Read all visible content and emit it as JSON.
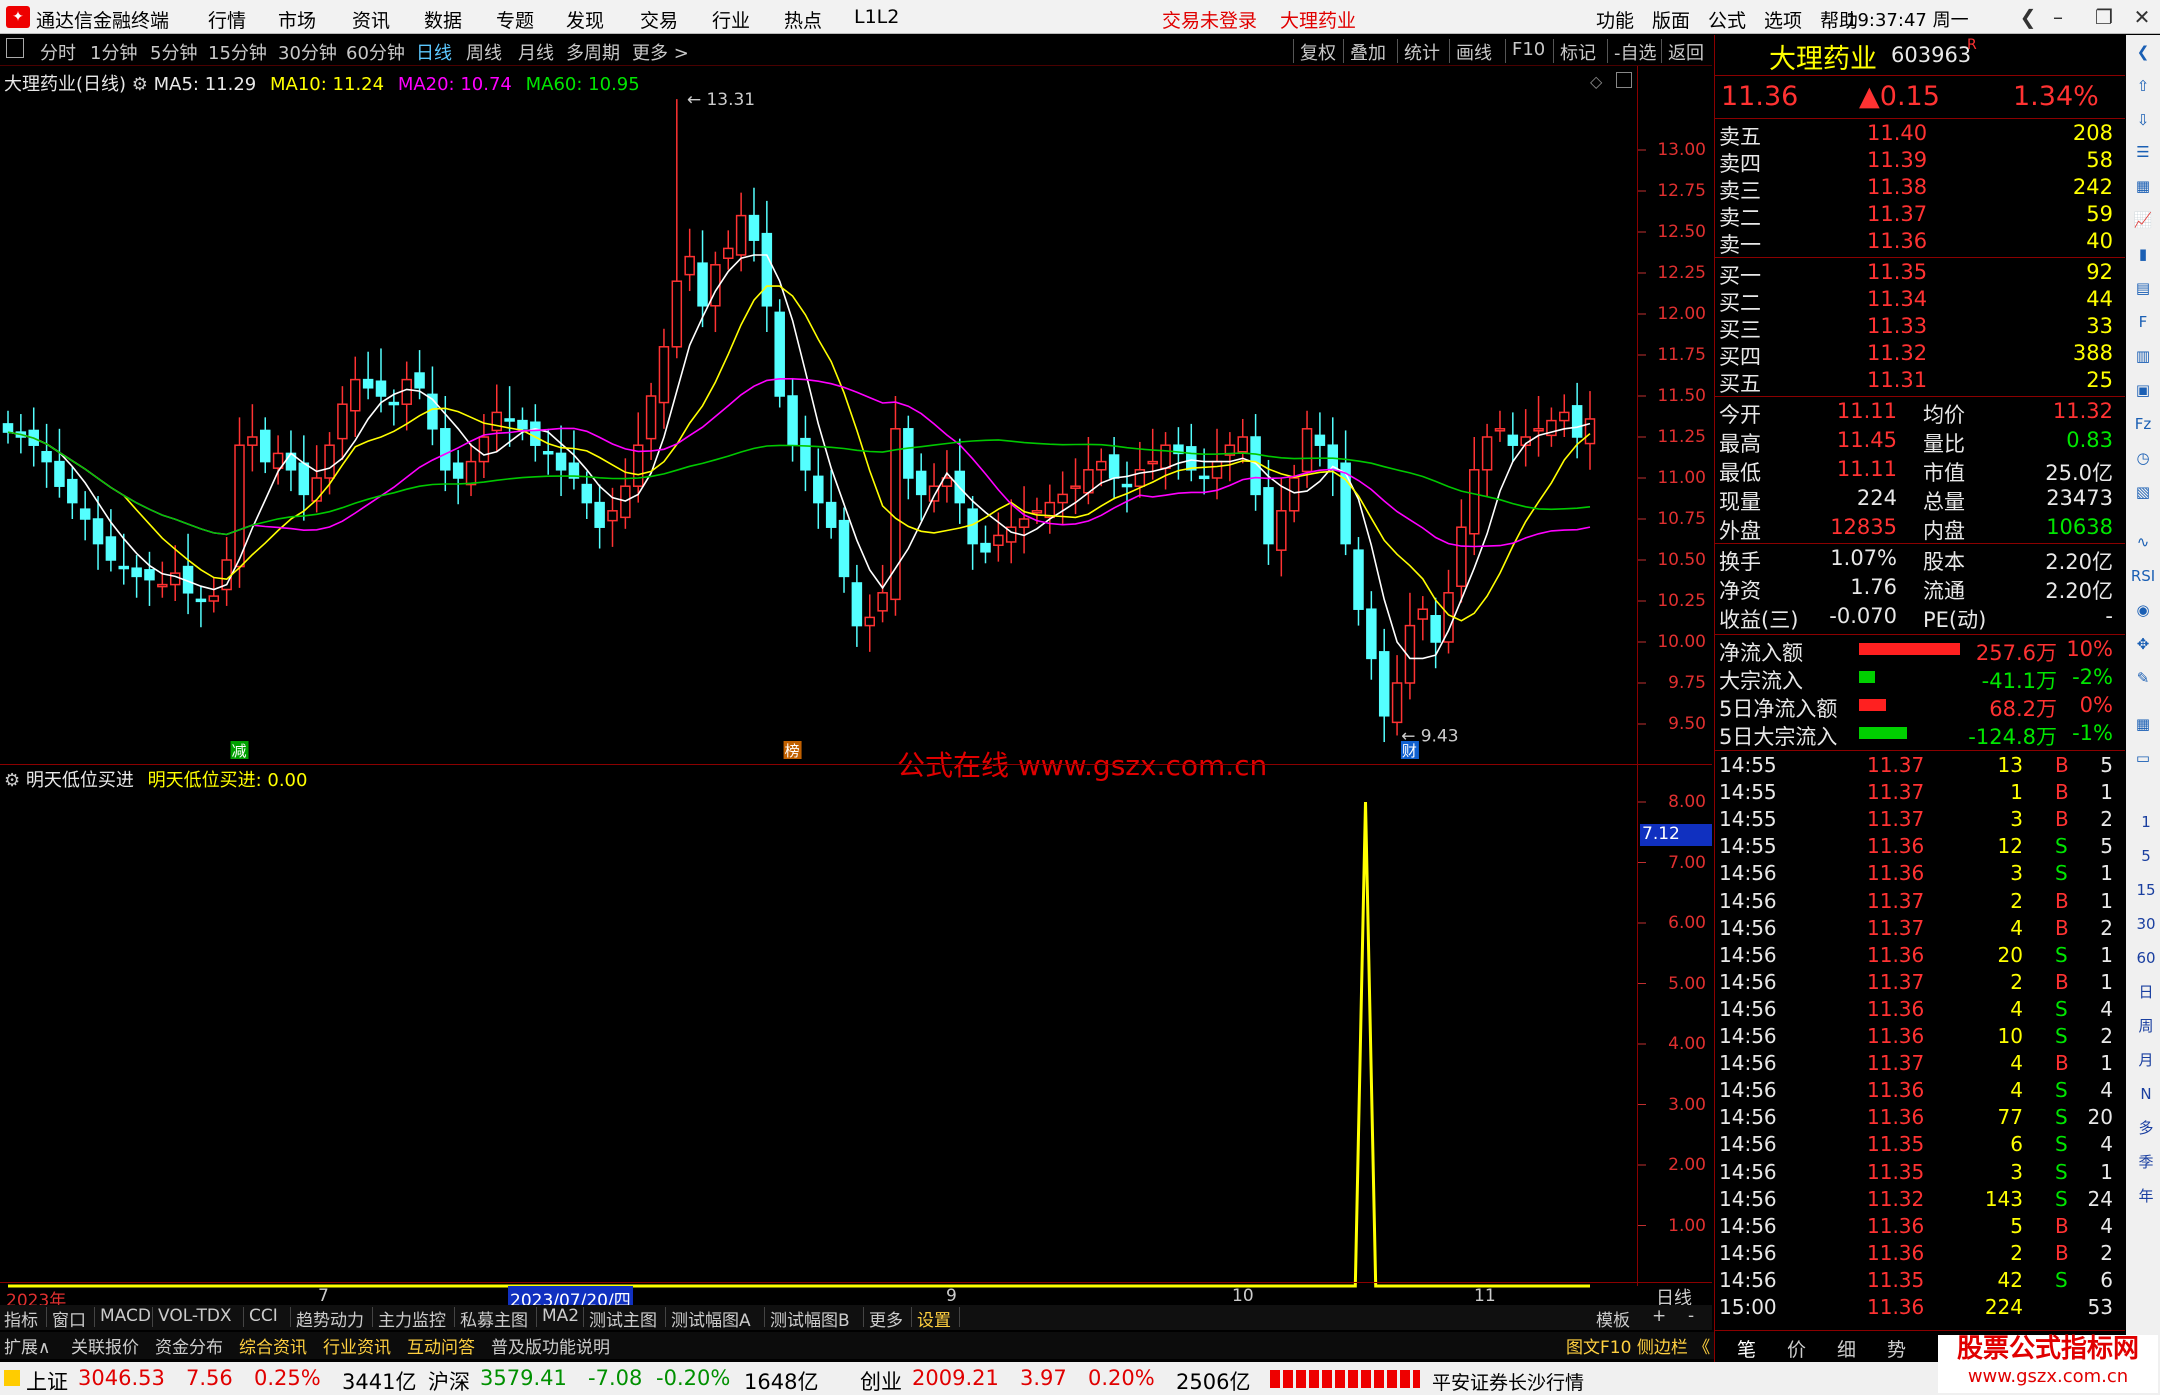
{
  "app": {
    "title": "通达信金融终端",
    "menus": [
      "行情",
      "市场",
      "资讯",
      "数据",
      "专题",
      "发现",
      "交易",
      "行业",
      "热点",
      "L1L2"
    ],
    "trade_status": "交易未登录",
    "stock_name_title": "大理药业",
    "right_menus": [
      "功能",
      "版面",
      "公式",
      "选项",
      "帮助"
    ],
    "time": "19:37:47 周一"
  },
  "toolbar": {
    "periods": [
      "分时",
      "1分钟",
      "5分钟",
      "15分钟",
      "30分钟",
      "60分钟",
      "日线",
      "周线",
      "月线",
      "多周期",
      "更多 >"
    ],
    "selected": "日线",
    "actions": [
      "复权",
      "叠加",
      "统计",
      "画线",
      "F10",
      "标记",
      "-自选",
      "返回"
    ]
  },
  "main_chart": {
    "legend_name": "大理药业(日线)",
    "ma5": "MA5: 11.29",
    "ma10": "MA10: 11.24",
    "ma20": "MA20: 10.74",
    "ma60": "MA60: 10.95",
    "high_mark": "13.31",
    "low_mark": "9.43",
    "markers": [
      "减",
      "榜",
      "财"
    ],
    "y_labels": [
      "13.00",
      "12.75",
      "12.50",
      "12.25",
      "12.00",
      "11.75",
      "11.50",
      "11.25",
      "11.00",
      "10.75",
      "10.50",
      "10.25",
      "10.00",
      "9.75",
      "9.50"
    ],
    "watermark": "公式在线  www.gszx.com.cn"
  },
  "indicator": {
    "name": "明天低位买进",
    "value_label": "明天低位买进: 0.00",
    "cursor_value": "7.12",
    "y_labels": [
      "8.00",
      "7.00",
      "6.00",
      "5.00",
      "4.00",
      "3.00",
      "2.00",
      "1.00"
    ]
  },
  "date_axis": {
    "labels": [
      "2023年",
      "7",
      "2023/07/20/四",
      "9",
      "10",
      "11"
    ],
    "period": "日线"
  },
  "chart_data": {
    "type": "line",
    "title": "",
    "series": [
      {
        "name": "明天低位买进",
        "values": [
          0,
          0,
          0,
          0,
          0,
          0,
          0,
          0,
          0,
          0,
          0,
          0,
          0,
          0,
          0,
          0,
          0,
          0,
          0,
          0,
          0,
          0,
          0,
          0,
          0,
          0,
          0,
          0,
          0,
          0,
          0,
          0,
          0,
          0,
          0,
          0,
          0,
          0,
          0,
          0,
          0,
          0,
          0,
          0,
          0,
          0,
          0,
          0,
          0,
          0,
          0,
          0,
          0,
          0,
          0,
          0,
          0,
          0,
          0,
          0,
          0,
          0,
          0,
          0,
          0,
          0,
          0,
          0,
          0,
          0,
          0,
          0,
          0,
          0,
          0,
          0,
          0,
          0,
          0,
          0,
          0,
          0,
          0,
          0,
          0,
          0,
          0,
          0,
          0,
          0,
          0,
          0,
          0,
          0,
          0,
          0,
          0,
          0,
          0,
          0,
          0,
          0,
          0,
          0,
          0,
          0,
          0,
          0,
          0,
          0,
          0,
          0,
          0,
          0,
          0,
          0,
          0,
          0,
          0,
          0,
          0,
          0,
          0,
          0,
          0,
          0,
          0,
          0,
          0,
          0,
          0,
          0,
          0,
          8,
          0,
          0,
          0,
          0,
          0,
          0,
          0,
          0,
          0,
          0,
          0,
          0,
          0,
          0,
          0,
          0,
          0,
          0,
          0,
          0,
          0,
          0
        ]
      }
    ],
    "ylim": [
      0,
      8.5
    ],
    "xlabel": "",
    "ylabel": ""
  },
  "quote": {
    "name": "大理药业",
    "code": "603963",
    "flag": "R",
    "price": "11.36",
    "change": "▲0.15",
    "pct": "1.34%",
    "asks": [
      {
        "label": "卖五",
        "price": "11.40",
        "vol": "208"
      },
      {
        "label": "卖四",
        "price": "11.39",
        "vol": "58"
      },
      {
        "label": "卖三",
        "price": "11.38",
        "vol": "242"
      },
      {
        "label": "卖二",
        "price": "11.37",
        "vol": "59"
      },
      {
        "label": "卖一",
        "price": "11.36",
        "vol": "40"
      }
    ],
    "bids": [
      {
        "label": "买一",
        "price": "11.35",
        "vol": "92"
      },
      {
        "label": "买二",
        "price": "11.34",
        "vol": "44"
      },
      {
        "label": "买三",
        "price": "11.33",
        "vol": "33"
      },
      {
        "label": "买四",
        "price": "11.32",
        "vol": "388"
      },
      {
        "label": "买五",
        "price": "11.31",
        "vol": "25"
      }
    ],
    "stats": [
      {
        "l1": "今开",
        "v1": "11.11",
        "l2": "均价",
        "v2": "11.32"
      },
      {
        "l1": "最高",
        "v1": "11.45",
        "l2": "量比",
        "v2": "0.83"
      },
      {
        "l1": "最低",
        "v1": "11.11",
        "l2": "市值",
        "v2": "25.0亿"
      },
      {
        "l1": "现量",
        "v1": "224",
        "l2": "总量",
        "v2": "23473"
      },
      {
        "l1": "外盘",
        "v1": "12835",
        "l2": "内盘",
        "v2": "10638"
      }
    ],
    "stats2": [
      {
        "l1": "换手",
        "v1": "1.07%",
        "l2": "股本",
        "v2": "2.20亿"
      },
      {
        "l1": "净资",
        "v1": "1.76",
        "l2": "流通",
        "v2": "2.20亿"
      },
      {
        "l1": "收益(三)",
        "v1": "-0.070",
        "l2": "PE(动)",
        "v2": "-"
      }
    ],
    "flows": [
      {
        "label": "净流入额",
        "value": "257.6万",
        "pct": "10%",
        "bar": 0.95,
        "color": "#ff2020"
      },
      {
        "label": "大宗流入",
        "value": "-41.1万",
        "pct": "-2%",
        "bar": 0.15,
        "color": "#00d000"
      },
      {
        "label": "5日净流入额",
        "value": "68.2万",
        "pct": "0%",
        "bar": 0.25,
        "color": "#ff2020"
      },
      {
        "label": "5日大宗流入",
        "value": "-124.8万",
        "pct": "-1%",
        "bar": 0.45,
        "color": "#00d000"
      }
    ],
    "ticks": [
      {
        "t": "14:55",
        "p": "11.37",
        "v": "13",
        "s": "B",
        "n": "5"
      },
      {
        "t": "14:55",
        "p": "11.37",
        "v": "1",
        "s": "B",
        "n": "1"
      },
      {
        "t": "14:55",
        "p": "11.37",
        "v": "3",
        "s": "B",
        "n": "2"
      },
      {
        "t": "14:55",
        "p": "11.36",
        "v": "12",
        "s": "S",
        "n": "5"
      },
      {
        "t": "14:56",
        "p": "11.36",
        "v": "3",
        "s": "S",
        "n": "1"
      },
      {
        "t": "14:56",
        "p": "11.37",
        "v": "2",
        "s": "B",
        "n": "1"
      },
      {
        "t": "14:56",
        "p": "11.37",
        "v": "4",
        "s": "B",
        "n": "2"
      },
      {
        "t": "14:56",
        "p": "11.36",
        "v": "20",
        "s": "S",
        "n": "1"
      },
      {
        "t": "14:56",
        "p": "11.37",
        "v": "2",
        "s": "B",
        "n": "1"
      },
      {
        "t": "14:56",
        "p": "11.36",
        "v": "4",
        "s": "S",
        "n": "4"
      },
      {
        "t": "14:56",
        "p": "11.36",
        "v": "10",
        "s": "S",
        "n": "2"
      },
      {
        "t": "14:56",
        "p": "11.37",
        "v": "4",
        "s": "B",
        "n": "1"
      },
      {
        "t": "14:56",
        "p": "11.36",
        "v": "4",
        "s": "S",
        "n": "4"
      },
      {
        "t": "14:56",
        "p": "11.36",
        "v": "77",
        "s": "S",
        "n": "20"
      },
      {
        "t": "14:56",
        "p": "11.35",
        "v": "6",
        "s": "S",
        "n": "4"
      },
      {
        "t": "14:56",
        "p": "11.35",
        "v": "3",
        "s": "S",
        "n": "1"
      },
      {
        "t": "14:56",
        "p": "11.32",
        "v": "143",
        "s": "S",
        "n": "24"
      },
      {
        "t": "14:56",
        "p": "11.36",
        "v": "5",
        "s": "B",
        "n": "4"
      },
      {
        "t": "14:56",
        "p": "11.36",
        "v": "2",
        "s": "B",
        "n": "2"
      },
      {
        "t": "14:56",
        "p": "11.35",
        "v": "42",
        "s": "S",
        "n": "6"
      },
      {
        "t": "15:00",
        "p": "11.36",
        "v": "224",
        "s": "",
        "n": "53"
      }
    ],
    "panel_tabs": [
      "笔",
      "价",
      "细",
      "势"
    ],
    "side_tool_labels": [
      "1",
      "5",
      "15",
      "30",
      "60",
      "日",
      "周",
      "月",
      "N",
      "多",
      "季",
      "年"
    ]
  },
  "tabs_row1": [
    "指标",
    "窗口",
    "MACD",
    "VOL-TDX",
    "CCI",
    "趋势动力",
    "主力监控",
    "私募主图",
    "MA2",
    "测试主图",
    "测试幅图A",
    "测试幅图B",
    "更多",
    "设置"
  ],
  "tabs_row1_right": [
    "模板",
    "+",
    "-"
  ],
  "tabs_row2": [
    "扩展∧",
    "关联报价",
    "资金分布",
    "综合资讯",
    "行业资讯",
    "互动问答",
    "普及版功能说明"
  ],
  "tabs_row2_right": "图文F10 侧边栏 《",
  "status": {
    "indexes": [
      {
        "name": "上证",
        "val": "3046.53",
        "chg": "7.56",
        "pct": "0.25%",
        "amt": "3441亿",
        "color": "red"
      },
      {
        "name": "沪深",
        "val": "3579.41",
        "chg": "-7.08",
        "pct": "-0.20%",
        "amt": "1648亿",
        "color": "green"
      },
      {
        "name": "创业",
        "val": "2009.21",
        "chg": "3.97",
        "pct": "0.20%",
        "amt": "2506亿",
        "color": "red"
      }
    ],
    "broker": "平安证券长沙行情",
    "logo_text": "股票公式指标网",
    "logo_url": "www.gszx.com.cn"
  },
  "colors": {
    "up": "#ff3232",
    "down": "#54ffff",
    "ma5": "#ffffff",
    "ma10": "#ffff00",
    "ma20": "#ff00ff",
    "ma60": "#00c800"
  }
}
